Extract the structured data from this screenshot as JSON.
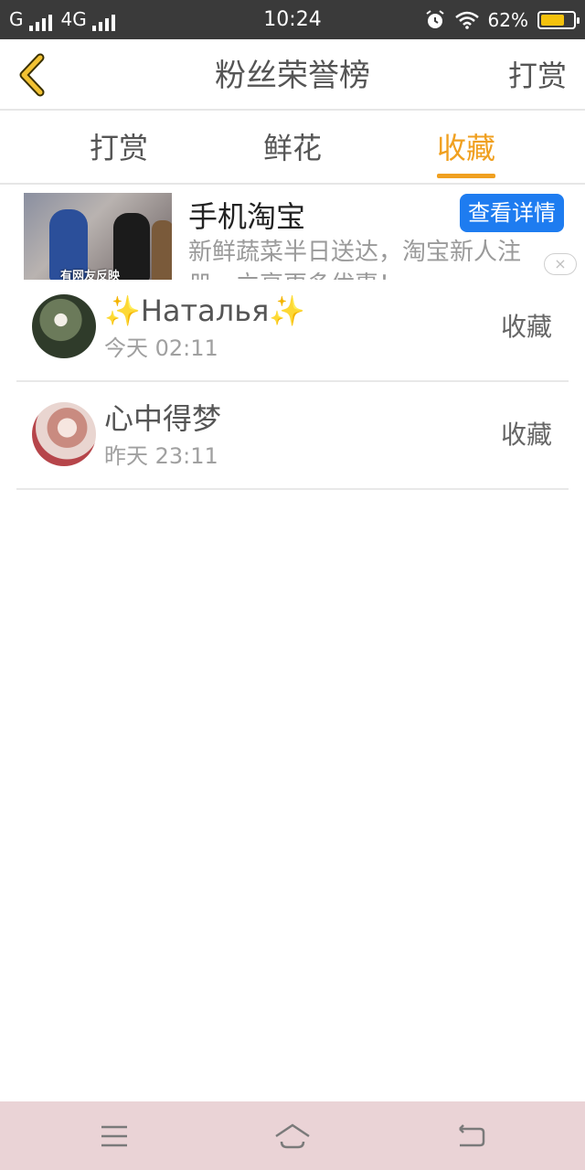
{
  "status_bar": {
    "carrier1": "G",
    "carrier2": "4G",
    "time": "10:24",
    "battery": "62%",
    "battery_level": 0.62,
    "icons": [
      "signal-icon",
      "alarm-icon",
      "wifi-icon",
      "battery-icon"
    ]
  },
  "header": {
    "title": "粉丝荣誉榜",
    "action": "打赏",
    "back_icon": "chevron-left-icon"
  },
  "tabs": [
    {
      "label": "打赏",
      "active": false
    },
    {
      "label": "鲜花",
      "active": false
    },
    {
      "label": "收藏",
      "active": true
    }
  ],
  "ad": {
    "title": "手机淘宝",
    "description": "新鲜蔬菜半日送达，淘宝新人注册，立享更多优惠！",
    "cta": "查看详情",
    "image_caption": "有网友反映",
    "close": "×"
  },
  "list": [
    {
      "name": "✨Наталья✨",
      "time": "今天 02:11",
      "action": "收藏"
    },
    {
      "name": "心中得梦",
      "time": "昨天 23:11",
      "action": "收藏"
    }
  ],
  "colors": {
    "accent": "#f0a020",
    "status_bar": "#3a3a3a",
    "cta": "#1e7cf0",
    "nav_bar": "#ead3d6"
  },
  "nav": [
    "menu-icon",
    "home-icon",
    "back-icon"
  ]
}
